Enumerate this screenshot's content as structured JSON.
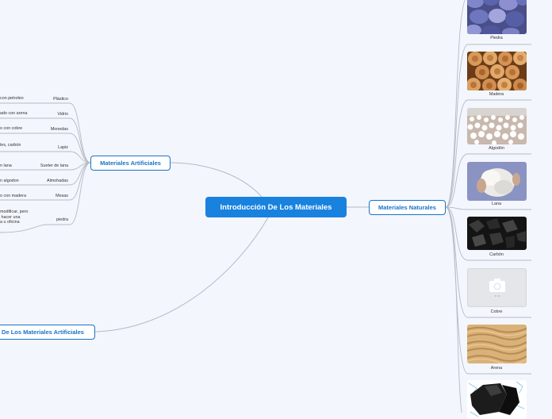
{
  "root": {
    "label": "Introducción De Los Materiales"
  },
  "artificiales": {
    "label": "Materiales Artificiales",
    "items": [
      {
        "label": "Plástico",
        "desc": "con petroleo"
      },
      {
        "label": "Vidrio",
        "desc": "ado con arena"
      },
      {
        "label": "Monedas",
        "desc": "o con cobre"
      },
      {
        "label": "Lapiz",
        "desc": "les, carbón"
      },
      {
        "label": "Sueter de lana",
        "desc": "n lana"
      },
      {
        "label": "Almohadas",
        "desc": "n algodon"
      },
      {
        "label": "Mesas",
        "desc": "o con madera"
      },
      {
        "label": "piedra",
        "desc": "modificar, pero\n hacer una\na u oficina"
      }
    ]
  },
  "naturales": {
    "label": "Materiales Naturales",
    "items": [
      {
        "label": "Piedra",
        "image": "pebbles"
      },
      {
        "label": "Madera",
        "image": "logs"
      },
      {
        "label": "Algodón",
        "image": "cotton"
      },
      {
        "label": "Lana",
        "image": "wool"
      },
      {
        "label": "Carbón",
        "image": "coal"
      },
      {
        "label": "Cobre",
        "image": "placeholder-camera-icon"
      },
      {
        "label": "Arena",
        "image": "sand"
      },
      {
        "label": "",
        "image": "rock"
      }
    ]
  },
  "bottom_node": {
    "label": "De Los Materiales Artificiales"
  },
  "colors": {
    "background": "#f3f6fd",
    "root_fill": "#1982df",
    "accent": "#1a73c7",
    "connector": "#b4bac4"
  }
}
